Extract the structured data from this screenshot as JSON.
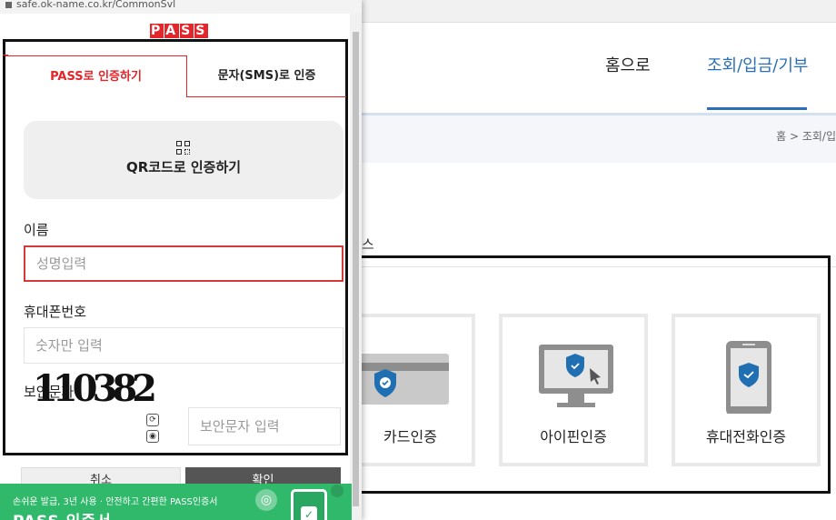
{
  "popup": {
    "url": "safe.ok-name.co.kr/CommonSvl",
    "logo_text": "PASS",
    "tabs": [
      {
        "label": "PASS로 인증하기"
      },
      {
        "label": "문자(SMS)로 인증"
      }
    ],
    "qr_button_label": "QR코드로 인증하기",
    "name_label": "이름",
    "name_placeholder": "성명입력",
    "phone_label": "휴대폰번호",
    "phone_placeholder": "숫자만 입력",
    "captcha_label": "보안문자",
    "captcha_text": "110382",
    "captcha_placeholder": "보안문자 입력",
    "cancel_label": "취소",
    "confirm_label": "확인",
    "banner": {
      "subtitle": "손쉬운 발급, 3년 사용 · 안전하고 간편한 PASS인증서",
      "title": "PASS 인증서"
    }
  },
  "site": {
    "nav": [
      {
        "label": "홈으로"
      },
      {
        "label": "조회/입금/기부"
      }
    ],
    "breadcrumb": "홈 > 조회/입",
    "section_fragment": "스",
    "auth_options": [
      {
        "label": "카드인증",
        "icon": "card-shield-icon"
      },
      {
        "label": "아이핀인증",
        "icon": "monitor-shield-icon"
      },
      {
        "label": "휴대전화인증",
        "icon": "phone-shield-icon"
      }
    ]
  },
  "colors": {
    "pass_red": "#e1262c",
    "site_blue": "#2a6fb8",
    "banner_green": "#30b86b",
    "shield_blue": "#1f6fb2"
  }
}
